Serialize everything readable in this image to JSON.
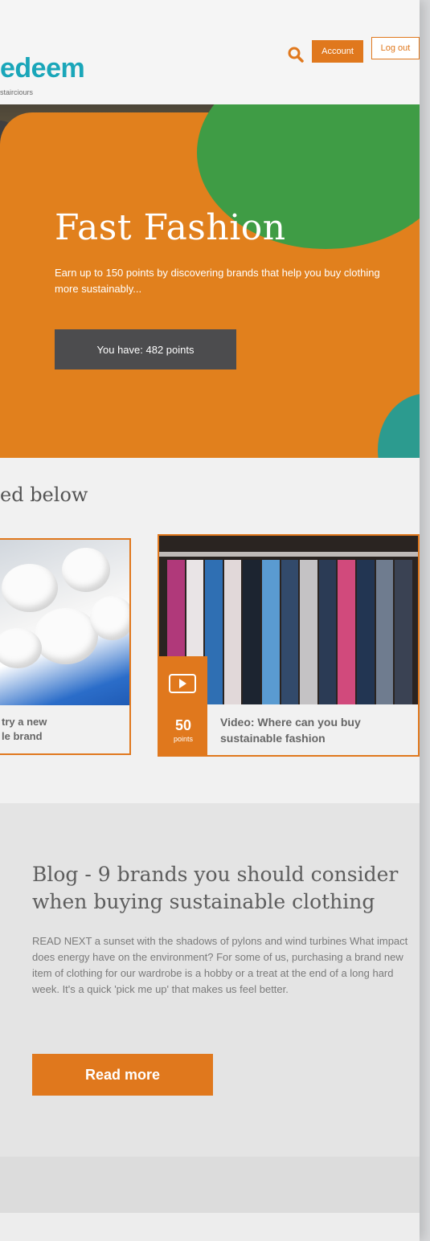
{
  "header": {
    "logo_text": "edeem",
    "logo_sub": "stairciours",
    "account_label": "Account",
    "logout_label": "Log out",
    "search_icon": "search-icon"
  },
  "hero": {
    "title": "Fast Fashion",
    "description": "Earn up to 150 points by discovering brands that help you buy clothing more sustainably...",
    "points_text": "You have: 482 points"
  },
  "section": {
    "heading": "ed below",
    "cards": [
      {
        "caption_line1": "try a new",
        "caption_line2": "le brand"
      },
      {
        "caption_line1": "Video: Where can you buy",
        "caption_line2": "sustainable fashion",
        "points_value": "50",
        "points_label": "points",
        "icon": "play-icon"
      }
    ]
  },
  "blog": {
    "title": "Blog - 9 brands you should consider when buying sustainable clothing",
    "body": "READ NEXT a sunset with the shadows of pylons and wind turbines What impact does energy have on the environment? For some of us, purchasing a brand new item of clothing for our wardrobe is a hobby or a treat at the end of a long hard week. It's a quick 'pick me up' that makes us feel better.",
    "button_label": "Read more"
  },
  "colors": {
    "brand_orange": "#e0781d",
    "brand_teal": "#1aa6b9",
    "hero_green": "#3f9c45",
    "dark_grey": "#4c4c4e"
  }
}
